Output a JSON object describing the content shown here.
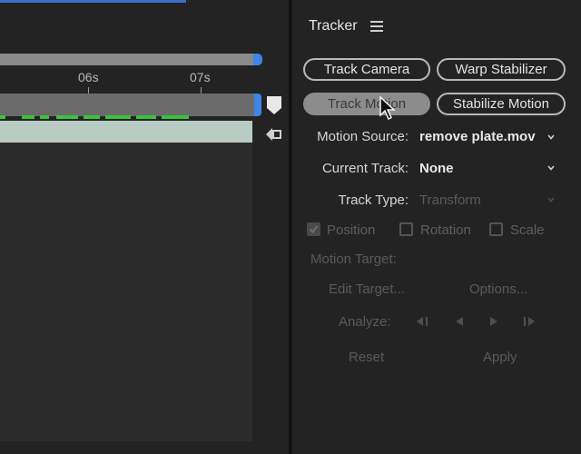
{
  "timeline": {
    "ruler_labels": [
      "06s",
      "07s"
    ]
  },
  "tracker": {
    "title": "Tracker",
    "buttons": {
      "track_camera": "Track Camera",
      "warp_stabilizer": "Warp Stabilizer",
      "track_motion": "Track Motion",
      "stabilize_motion": "Stabilize Motion"
    },
    "motion_source": {
      "label": "Motion Source:",
      "value": "remove plate.mov"
    },
    "current_track": {
      "label": "Current Track:",
      "value": "None"
    },
    "track_type": {
      "label": "Track Type:",
      "value": "Transform"
    },
    "checkboxes": [
      {
        "label": "Position",
        "checked": true
      },
      {
        "label": "Rotation",
        "checked": false
      },
      {
        "label": "Scale",
        "checked": false
      }
    ],
    "motion_target_label": "Motion Target:",
    "edit_target_label": "Edit Target...",
    "options_label": "Options...",
    "analyze_label": "Analyze:",
    "reset_label": "Reset",
    "apply_label": "Apply"
  },
  "colors": {
    "accent_blue": "#3b86e6",
    "keyframe_green": "#39c43c",
    "clip": "#b9ccc4"
  }
}
